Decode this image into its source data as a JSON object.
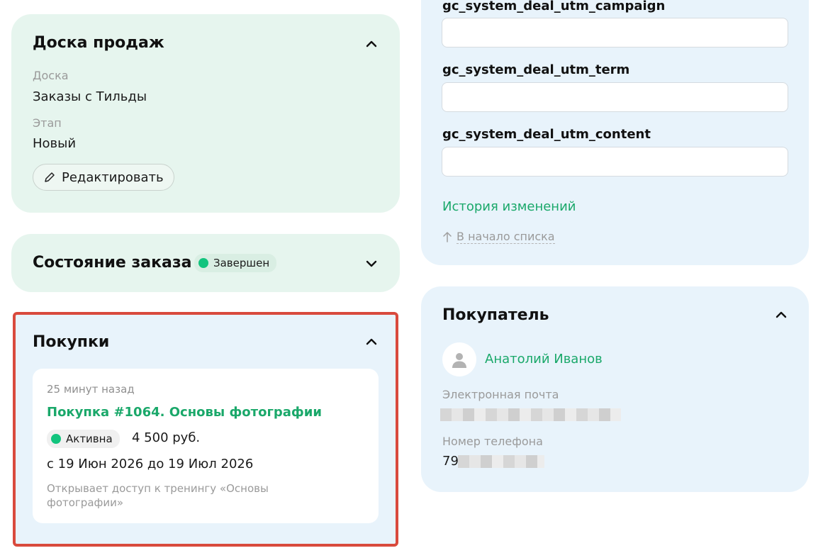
{
  "board_card": {
    "title": "Доска продаж",
    "board_label": "Доска",
    "board_value": "Заказы с Тильды",
    "stage_label": "Этап",
    "stage_value": "Новый",
    "edit_label": "Редактировать"
  },
  "order_state_card": {
    "title": "Состояние заказа",
    "status": "Завершен",
    "status_color": "#12c47e"
  },
  "purchases_card": {
    "title": "Покупки",
    "item": {
      "time": "25 минут назад",
      "name": "Покупка #1064. Основы фотографии",
      "status": "Активна",
      "price": "4 500 руб.",
      "period": "с 19 Июн 2026 до 19 Июл 2026",
      "description": "Открывает доступ к тренингу «Основы фотографии»"
    }
  },
  "fields_card": {
    "fields": [
      {
        "label": "gc_system_deal_utm_campaign",
        "value": ""
      },
      {
        "label": "gc_system_deal_utm_term",
        "value": ""
      },
      {
        "label": "gc_system_deal_utm_content",
        "value": ""
      }
    ],
    "history_link": "История изменений",
    "top_link": "В начало списка"
  },
  "buyer_card": {
    "title": "Покупатель",
    "name": "Анатолий Иванов",
    "email_label": "Электронная почта",
    "phone_label": "Номер телефона",
    "phone_prefix": "79"
  },
  "colors": {
    "accent_green": "#1aa86a",
    "highlight_red": "#d94a3d"
  }
}
